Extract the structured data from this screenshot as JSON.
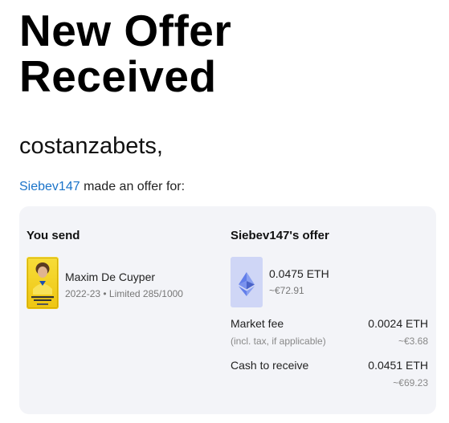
{
  "headline": {
    "line1": "New Offer",
    "line2": "Received"
  },
  "greeting": "costanzabets,",
  "intro": {
    "username": "Siebev147",
    "text": " made an offer for:"
  },
  "offer": {
    "you_send_title": "You send",
    "player": {
      "name": "Maxim De Cuyper",
      "meta": "2022-23 • Limited 285/1000",
      "card_label": "MAXIM DE CUYPER",
      "card_color": "#f4d21c"
    },
    "their_offer_title": "Siebev147's offer",
    "amount": "0.0475 ETH",
    "amount_fiat": "~€72.91",
    "currency_icon": "ethereum-icon",
    "market_fee": {
      "label": "Market fee",
      "sublabel": "(incl. tax, if applicable)",
      "value": "0.0024 ETH",
      "value_fiat": "~€3.68"
    },
    "cash_to_receive": {
      "label": "Cash to receive",
      "value": "0.0451 ETH",
      "value_fiat": "~€69.23"
    }
  },
  "colors": {
    "link": "#1a73c9",
    "card_background": "#f3f4f8",
    "eth_tile": "#cfd6f6",
    "eth_blue": "#627eea"
  }
}
